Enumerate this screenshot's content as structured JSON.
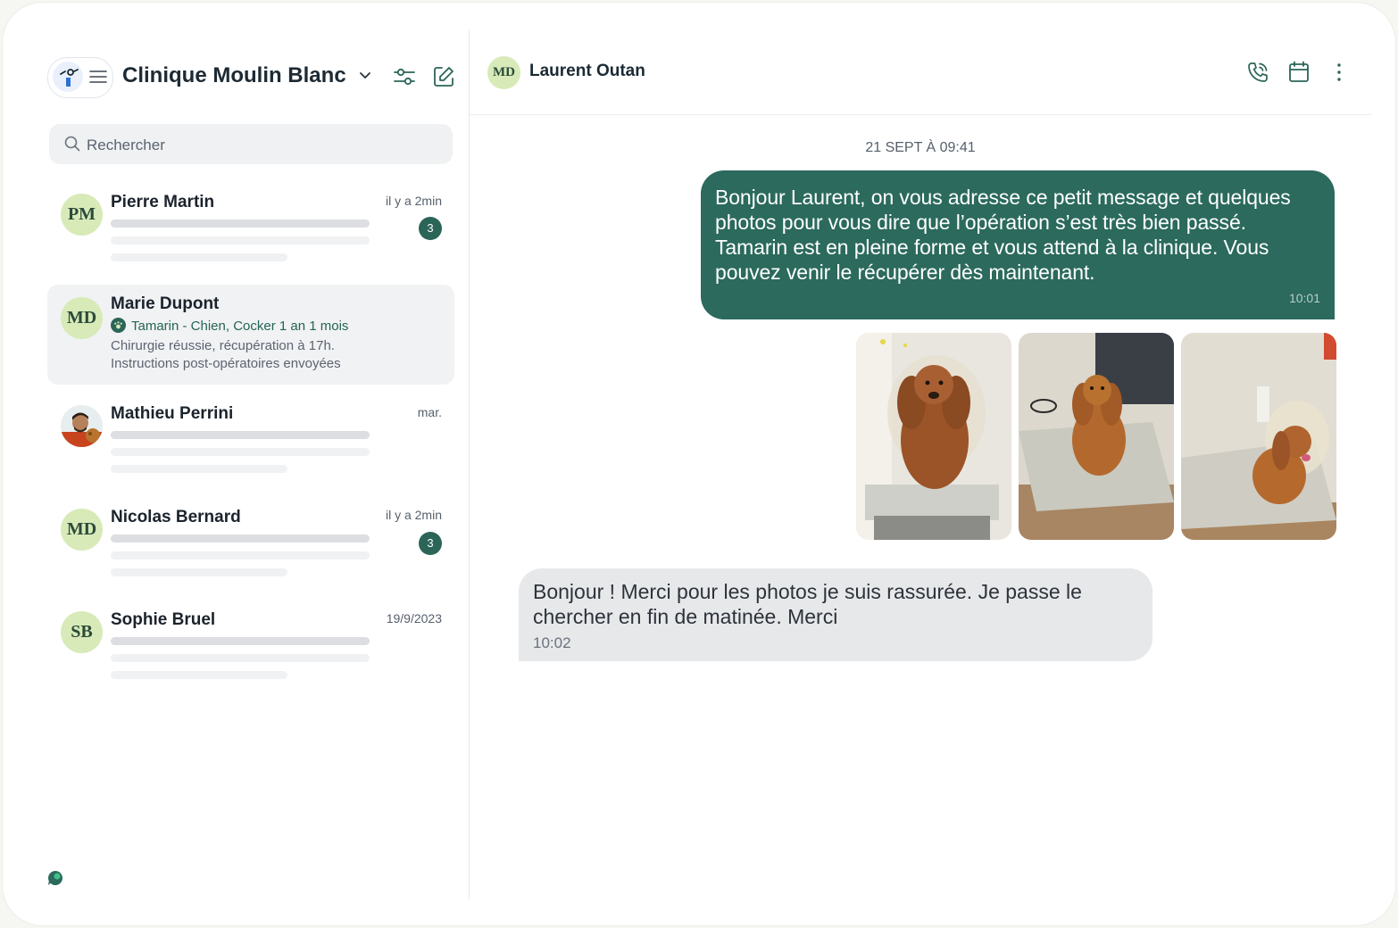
{
  "sidebar": {
    "clinic_name": "Clinique Moulin Blanc",
    "search_placeholder": "Rechercher",
    "conversations": [
      {
        "initials": "PM",
        "name": "Pierre Martin",
        "time": "il y a 2min",
        "unread": "3"
      },
      {
        "initials": "MD",
        "name": "Marie Dupont",
        "pet": "Tamarin - Chien, Cocker 1 an 1 mois",
        "preview_line1": "Chirurgie réussie, récupération à 17h.",
        "preview_line2": "Instructions post-opératoires envoyées"
      },
      {
        "name": "Mathieu Perrini",
        "time": "mar."
      },
      {
        "initials": "MD",
        "name": "Nicolas Bernard",
        "time": "il y a 2min",
        "unread": "3"
      },
      {
        "initials": "SB",
        "name": "Sophie Bruel",
        "time": "19/9/2023"
      }
    ]
  },
  "chat": {
    "contact_initials": "MD",
    "contact_name": "Laurent Outan",
    "date_separator": "21 SEPT À 09:41",
    "messages": [
      {
        "direction": "outgoing",
        "text": "Bonjour Laurent, on vous adresse ce petit message et quelques photos pour vous dire que l’opération s’est très bien passé. Tamarin est en pleine forme et vous attend à la clinique. Vous pouvez venir le récupérer dès maintenant.",
        "time": "10:01"
      },
      {
        "direction": "incoming",
        "text": "Bonjour ! Merci pour les photos je suis rassurée. Je passe le chercher en fin de matinée. Merci",
        "time": "10:02"
      }
    ]
  },
  "colors": {
    "accent": "#2b6a5d",
    "avatar_bg": "#d7eab8",
    "incoming_bubble": "#e7e8ea"
  }
}
